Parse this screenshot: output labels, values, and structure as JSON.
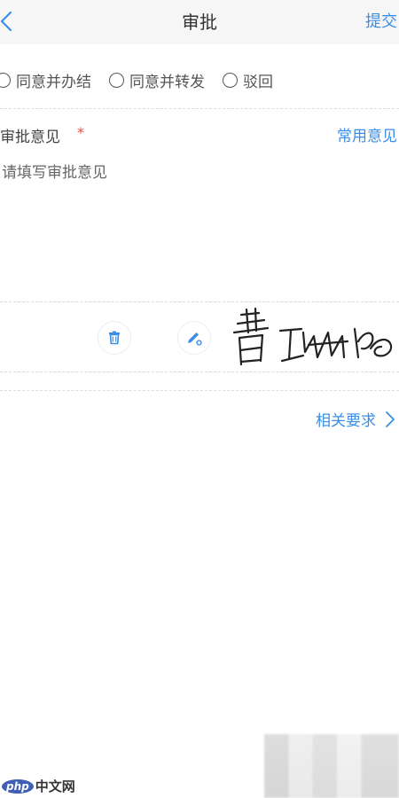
{
  "header": {
    "title": "审批",
    "submit_label": "提交"
  },
  "options": [
    {
      "label": "同意并办结",
      "selected": false
    },
    {
      "label": "同意并转发",
      "selected": false
    },
    {
      "label": "驳回",
      "selected": false
    }
  ],
  "opinion": {
    "label": "审批意见",
    "required_mark": "*",
    "common_link": "常用意见",
    "placeholder": "请填写审批意见",
    "value": ""
  },
  "signature": {
    "delete_icon": "trash-icon",
    "draw_icon": "pen-icon"
  },
  "requirements": {
    "label": "相关要求",
    "arrow": "〉"
  },
  "watermark": {
    "badge": "php",
    "text": "中文网"
  },
  "colors": {
    "accent": "#3a8ee6",
    "required": "#e54848",
    "header_bg": "#f6f6f6"
  }
}
